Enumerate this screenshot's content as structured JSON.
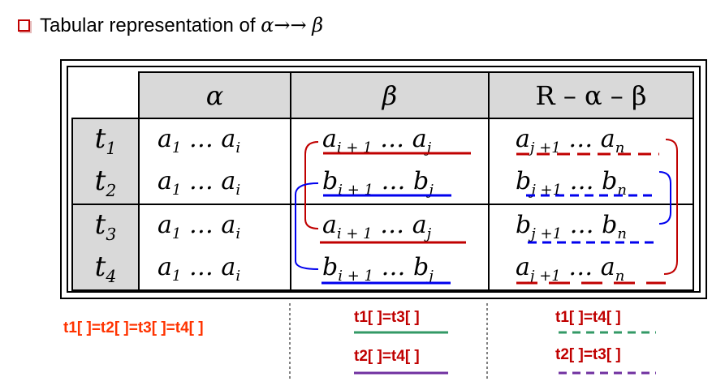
{
  "title": {
    "text": "Tabular representation of",
    "alpha": "α",
    "arrow": "→→",
    "beta": "β"
  },
  "table": {
    "headers": [
      "α",
      "β",
      "R – α – β"
    ],
    "rows": [
      {
        "tuple": "t",
        "index": "1",
        "alpha": [
          "a",
          "1",
          " … a",
          "i"
        ],
        "beta": [
          "a",
          "i + 1",
          " … a",
          "j"
        ],
        "rest": [
          "a",
          "j +1",
          " … a",
          "n"
        ]
      },
      {
        "tuple": "t",
        "index": "2",
        "alpha": [
          "a",
          "1",
          " … a",
          "i"
        ],
        "beta": [
          "b",
          "i + 1",
          " … b",
          "j"
        ],
        "rest": [
          "b",
          "j +1",
          " … b",
          "n"
        ]
      },
      {
        "tuple": "t",
        "index": "3",
        "alpha": [
          "a",
          "1",
          " … a",
          "i"
        ],
        "beta": [
          "a",
          "i + 1",
          " … a",
          "j"
        ],
        "rest": [
          "b",
          "j +1",
          " … b",
          "n"
        ]
      },
      {
        "tuple": "t",
        "index": "4",
        "alpha": [
          "a",
          "1",
          " … a",
          "i"
        ],
        "beta": [
          "b",
          "i + 1",
          " … b",
          "j"
        ],
        "rest": [
          "a",
          "j +1",
          " … a",
          "n"
        ]
      }
    ]
  },
  "conditions": {
    "alpha_eq": "t1[ ]=t2[ ]=t3[ ]=t4[ ]",
    "beta_eq_1": "t1[ ]=t3[ ]",
    "beta_eq_2": "t2[ ]=t4[ ]",
    "rest_eq_1": "t1[ ]=t4[ ]",
    "rest_eq_2": "t2[ ]=t3[ ]"
  },
  "colors": {
    "red": "#c00000",
    "blue": "#0000ee",
    "green": "#339966",
    "purple": "#7030a0",
    "orange_red": "#ff3300"
  }
}
